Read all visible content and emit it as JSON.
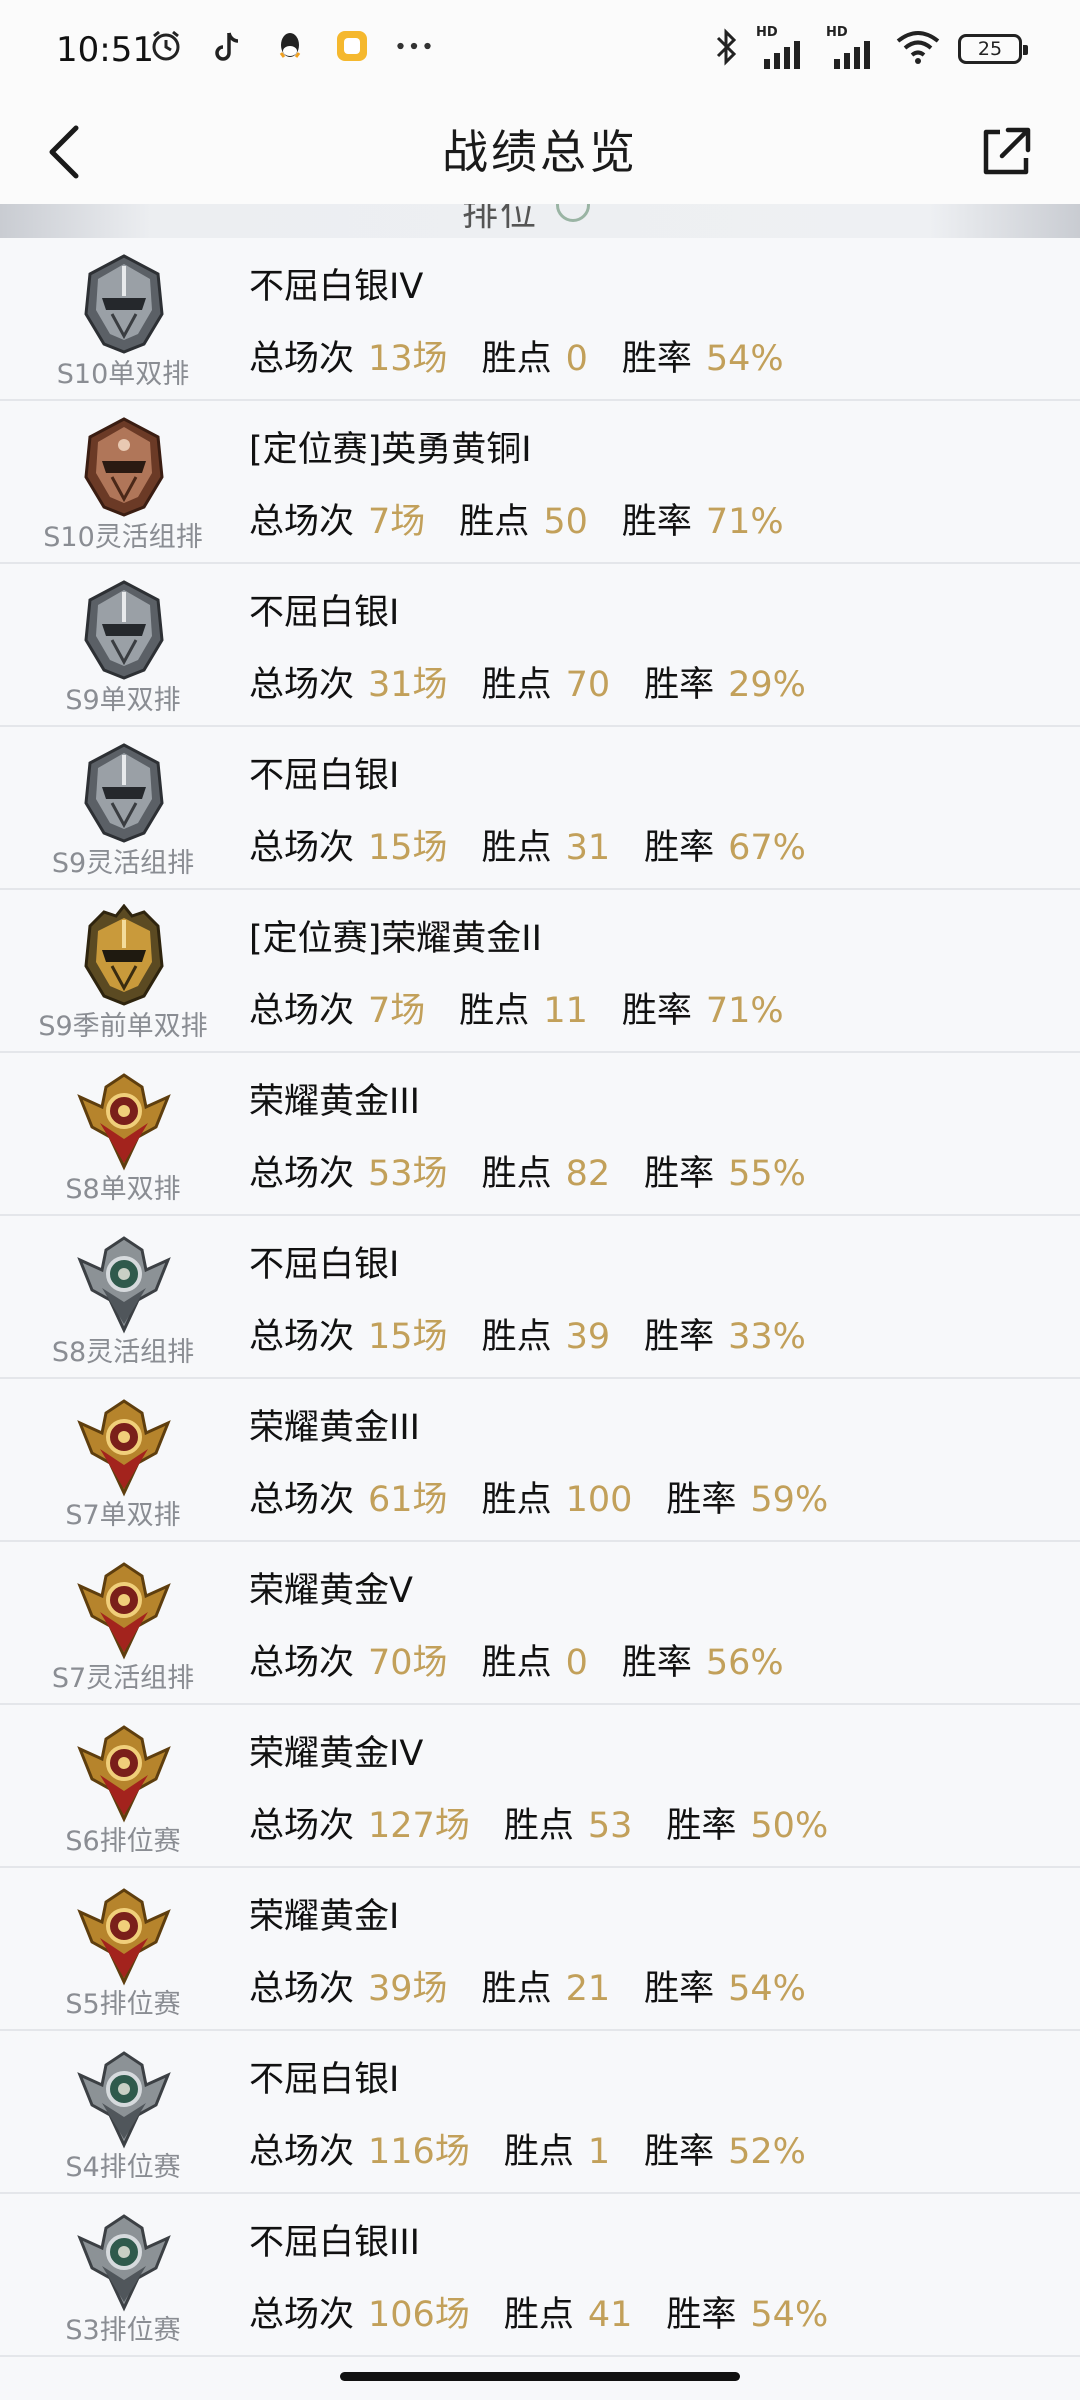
{
  "status_bar": {
    "time": "10:51",
    "battery": "25",
    "hd1": "HD",
    "hd2": "HD",
    "left_icons": [
      "alarm-icon",
      "tiktok-icon",
      "qq-icon",
      "app-notification-icon",
      "more-dots-icon"
    ],
    "right_icons": [
      "bluetooth-icon",
      "signal-icon",
      "signal-icon",
      "wifi-icon",
      "battery-icon"
    ]
  },
  "header": {
    "title": "战绩总览"
  },
  "peek_section": {
    "text": "排位"
  },
  "stat_labels": {
    "games": "总场次",
    "points": "胜点",
    "winrate": "胜率"
  },
  "rows": [
    {
      "season": "S10单双排",
      "rank": "不屈白银IV",
      "games": "13场",
      "points": "0",
      "winrate": "54%",
      "tier": "silver-helmet"
    },
    {
      "season": "S10灵活组排",
      "rank": "[定位赛]英勇黄铜I",
      "games": "7场",
      "points": "50",
      "winrate": "71%",
      "tier": "bronze-helmet"
    },
    {
      "season": "S9单双排",
      "rank": "不屈白银I",
      "games": "31场",
      "points": "70",
      "winrate": "29%",
      "tier": "silver-helmet"
    },
    {
      "season": "S9灵活组排",
      "rank": "不屈白银I",
      "games": "15场",
      "points": "31",
      "winrate": "67%",
      "tier": "silver-helmet"
    },
    {
      "season": "S9季前单双排",
      "rank": "[定位赛]荣耀黄金II",
      "games": "7场",
      "points": "11",
      "winrate": "71%",
      "tier": "gold-helmet"
    },
    {
      "season": "S8单双排",
      "rank": "荣耀黄金III",
      "games": "53场",
      "points": "82",
      "winrate": "55%",
      "tier": "gold-crest"
    },
    {
      "season": "S8灵活组排",
      "rank": "不屈白银I",
      "games": "15场",
      "points": "39",
      "winrate": "33%",
      "tier": "silver-crest"
    },
    {
      "season": "S7单双排",
      "rank": "荣耀黄金III",
      "games": "61场",
      "points": "100",
      "winrate": "59%",
      "tier": "gold-crest"
    },
    {
      "season": "S7灵活组排",
      "rank": "荣耀黄金V",
      "games": "70场",
      "points": "0",
      "winrate": "56%",
      "tier": "gold-crest"
    },
    {
      "season": "S6排位赛",
      "rank": "荣耀黄金IV",
      "games": "127场",
      "points": "53",
      "winrate": "50%",
      "tier": "gold-crest"
    },
    {
      "season": "S5排位赛",
      "rank": "荣耀黄金I",
      "games": "39场",
      "points": "21",
      "winrate": "54%",
      "tier": "gold-crest"
    },
    {
      "season": "S4排位赛",
      "rank": "不屈白银I",
      "games": "116场",
      "points": "1",
      "winrate": "52%",
      "tier": "silver-crest"
    },
    {
      "season": "S3排位赛",
      "rank": "不屈白银III",
      "games": "106场",
      "points": "41",
      "winrate": "54%",
      "tier": "silver-crest"
    }
  ],
  "colors": {
    "value_gold": "#c2a05a",
    "background": "#f7f8fa",
    "divider": "#e4e6ea",
    "season_gray": "#8a8d93"
  }
}
